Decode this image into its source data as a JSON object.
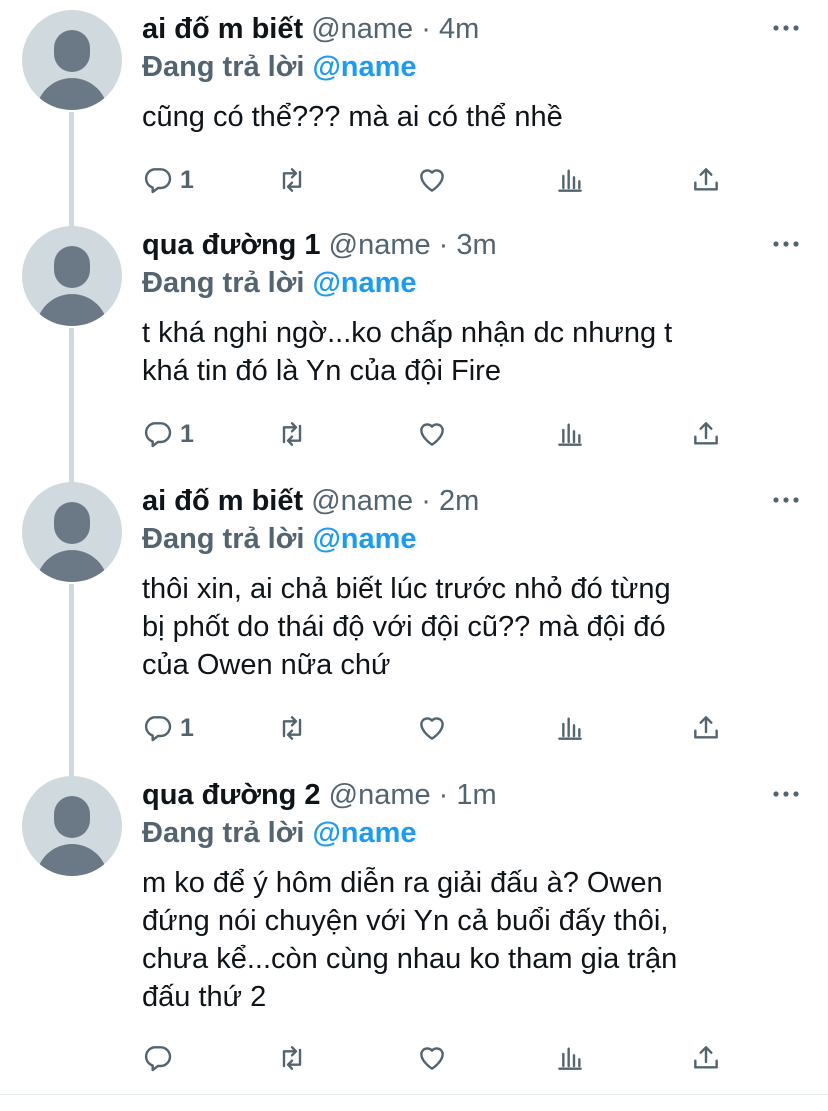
{
  "tweets": [
    {
      "display_name": "ai đố m biết",
      "handle": "@name",
      "separator": "·",
      "time": "4m",
      "reply_prefix": "Đang trả lời",
      "reply_handle": "@name",
      "lines": [
        "cũng có thể??? mà ai có thể nhề"
      ],
      "reply_count": "1"
    },
    {
      "display_name": "qua đường 1",
      "handle": "@name",
      "separator": "·",
      "time": "3m",
      "reply_prefix": "Đang trả lời",
      "reply_handle": "@name",
      "lines": [
        "t khá nghi ngờ...ko chấp nhận dc nhưng t",
        "khá tin đó là Yn của đội Fire"
      ],
      "reply_count": "1"
    },
    {
      "display_name": "ai đố m biết",
      "handle": "@name",
      "separator": "·",
      "time": "2m",
      "reply_prefix": "Đang trả lời",
      "reply_handle": "@name",
      "lines": [
        "thôi xin, ai chả biết lúc trước nhỏ đó từng",
        "bị phốt do thái độ với đội cũ?? mà đội đó",
        "của Owen nữa chứ"
      ],
      "reply_count": "1"
    },
    {
      "display_name": "qua đường 2",
      "handle": "@name",
      "separator": "·",
      "time": "1m",
      "reply_prefix": "Đang trả lời",
      "reply_handle": "@name",
      "lines": [
        "m ko để ý hôm diễn ra giải đấu à? Owen",
        "đứng nói chuyện với Yn cả buổi đấy thôi,",
        "chưa kể...còn cùng nhau ko tham gia trận",
        "đấu thứ 2"
      ],
      "reply_count": ""
    }
  ],
  "icons": {
    "reply": "reply-icon",
    "retweet": "retweet-icon",
    "like": "heart-icon",
    "views": "analytics-icon",
    "share": "share-icon",
    "more": "more-icon"
  },
  "colors": {
    "link": "#1d9bf0",
    "secondary": "#536471",
    "avatar_bg": "#cfd9de",
    "avatar_fg": "#6b7886"
  }
}
